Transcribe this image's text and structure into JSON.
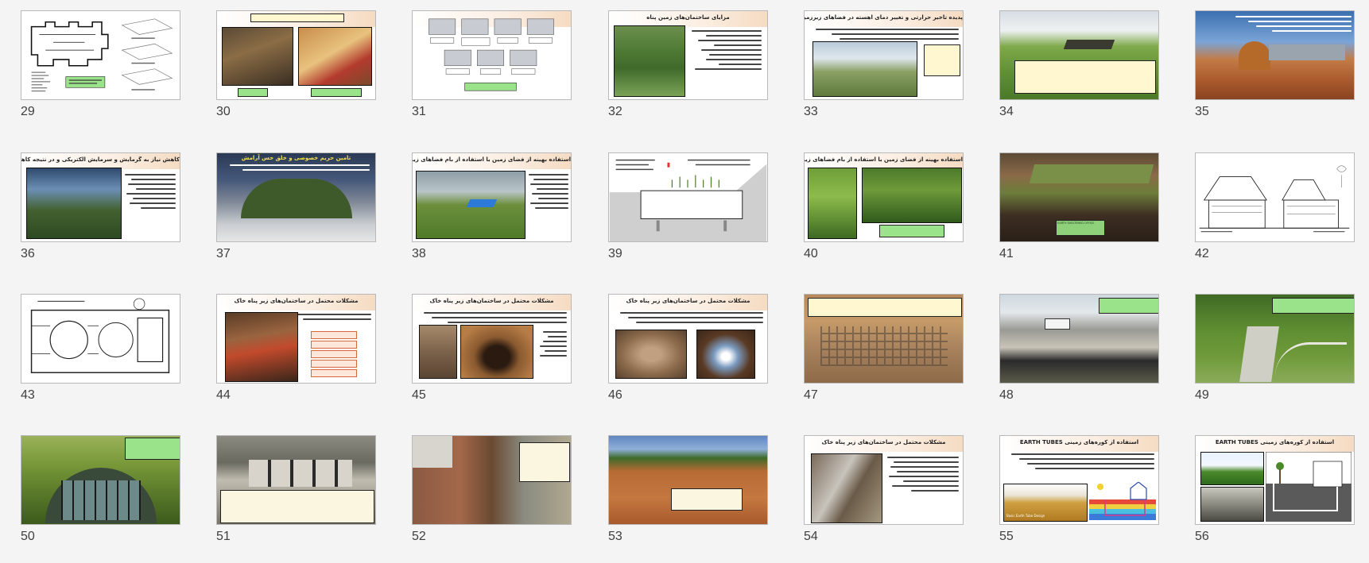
{
  "slides": [
    {
      "number": "29",
      "title": ""
    },
    {
      "number": "30",
      "title": ""
    },
    {
      "number": "31",
      "title": ""
    },
    {
      "number": "32",
      "title": "مزایای ساختمان‌های زمین پناه"
    },
    {
      "number": "33",
      "title": "پدیده تاخیر حرارتی و تغییر دمای آهسته در فضاهای زیرزمینی"
    },
    {
      "number": "34",
      "title": ""
    },
    {
      "number": "35",
      "title": ""
    },
    {
      "number": "36",
      "title": "کاهش نیاز به گرمایش و سرمایش الکتریکی و در نتیجه کاهش انرژی مصرفی"
    },
    {
      "number": "37",
      "title": "تامین حریم خصوصی و خلق حس آرامش"
    },
    {
      "number": "38",
      "title": "استفاده بهینه از فضای زمین با استفاده از بام فضاهای زیرزمینی"
    },
    {
      "number": "39",
      "title": ""
    },
    {
      "number": "40",
      "title": "استفاده بهینه از فضای زمین با استفاده از بام فضاهای زیرزمینی"
    },
    {
      "number": "41",
      "title": ""
    },
    {
      "number": "42",
      "title": ""
    },
    {
      "number": "43",
      "title": ""
    },
    {
      "number": "44",
      "title": "مشکلات محتمل در ساختمان‌های زیر پناه خاک"
    },
    {
      "number": "45",
      "title": "مشکلات محتمل در ساختمان‌های زیر پناه خاک"
    },
    {
      "number": "46",
      "title": "مشکلات محتمل در ساختمان‌های زیر پناه خاک"
    },
    {
      "number": "47",
      "title": ""
    },
    {
      "number": "48",
      "title": ""
    },
    {
      "number": "49",
      "title": ""
    },
    {
      "number": "50",
      "title": ""
    },
    {
      "number": "51",
      "title": ""
    },
    {
      "number": "52",
      "title": ""
    },
    {
      "number": "53",
      "title": ""
    },
    {
      "number": "54",
      "title": "مشکلات محتمل در ساختمان‌های زیر پناه خاک"
    },
    {
      "number": "55",
      "title": "استفاده از کوره‌های زمینی EARTH TUBES"
    },
    {
      "number": "56",
      "title": "استفاده از کوره‌های زمینی EARTH TUBES"
    }
  ],
  "slide41_caption": "EARTH SHELTERED OFFICE",
  "slide55_caption": "Basic Earth Tube Design"
}
